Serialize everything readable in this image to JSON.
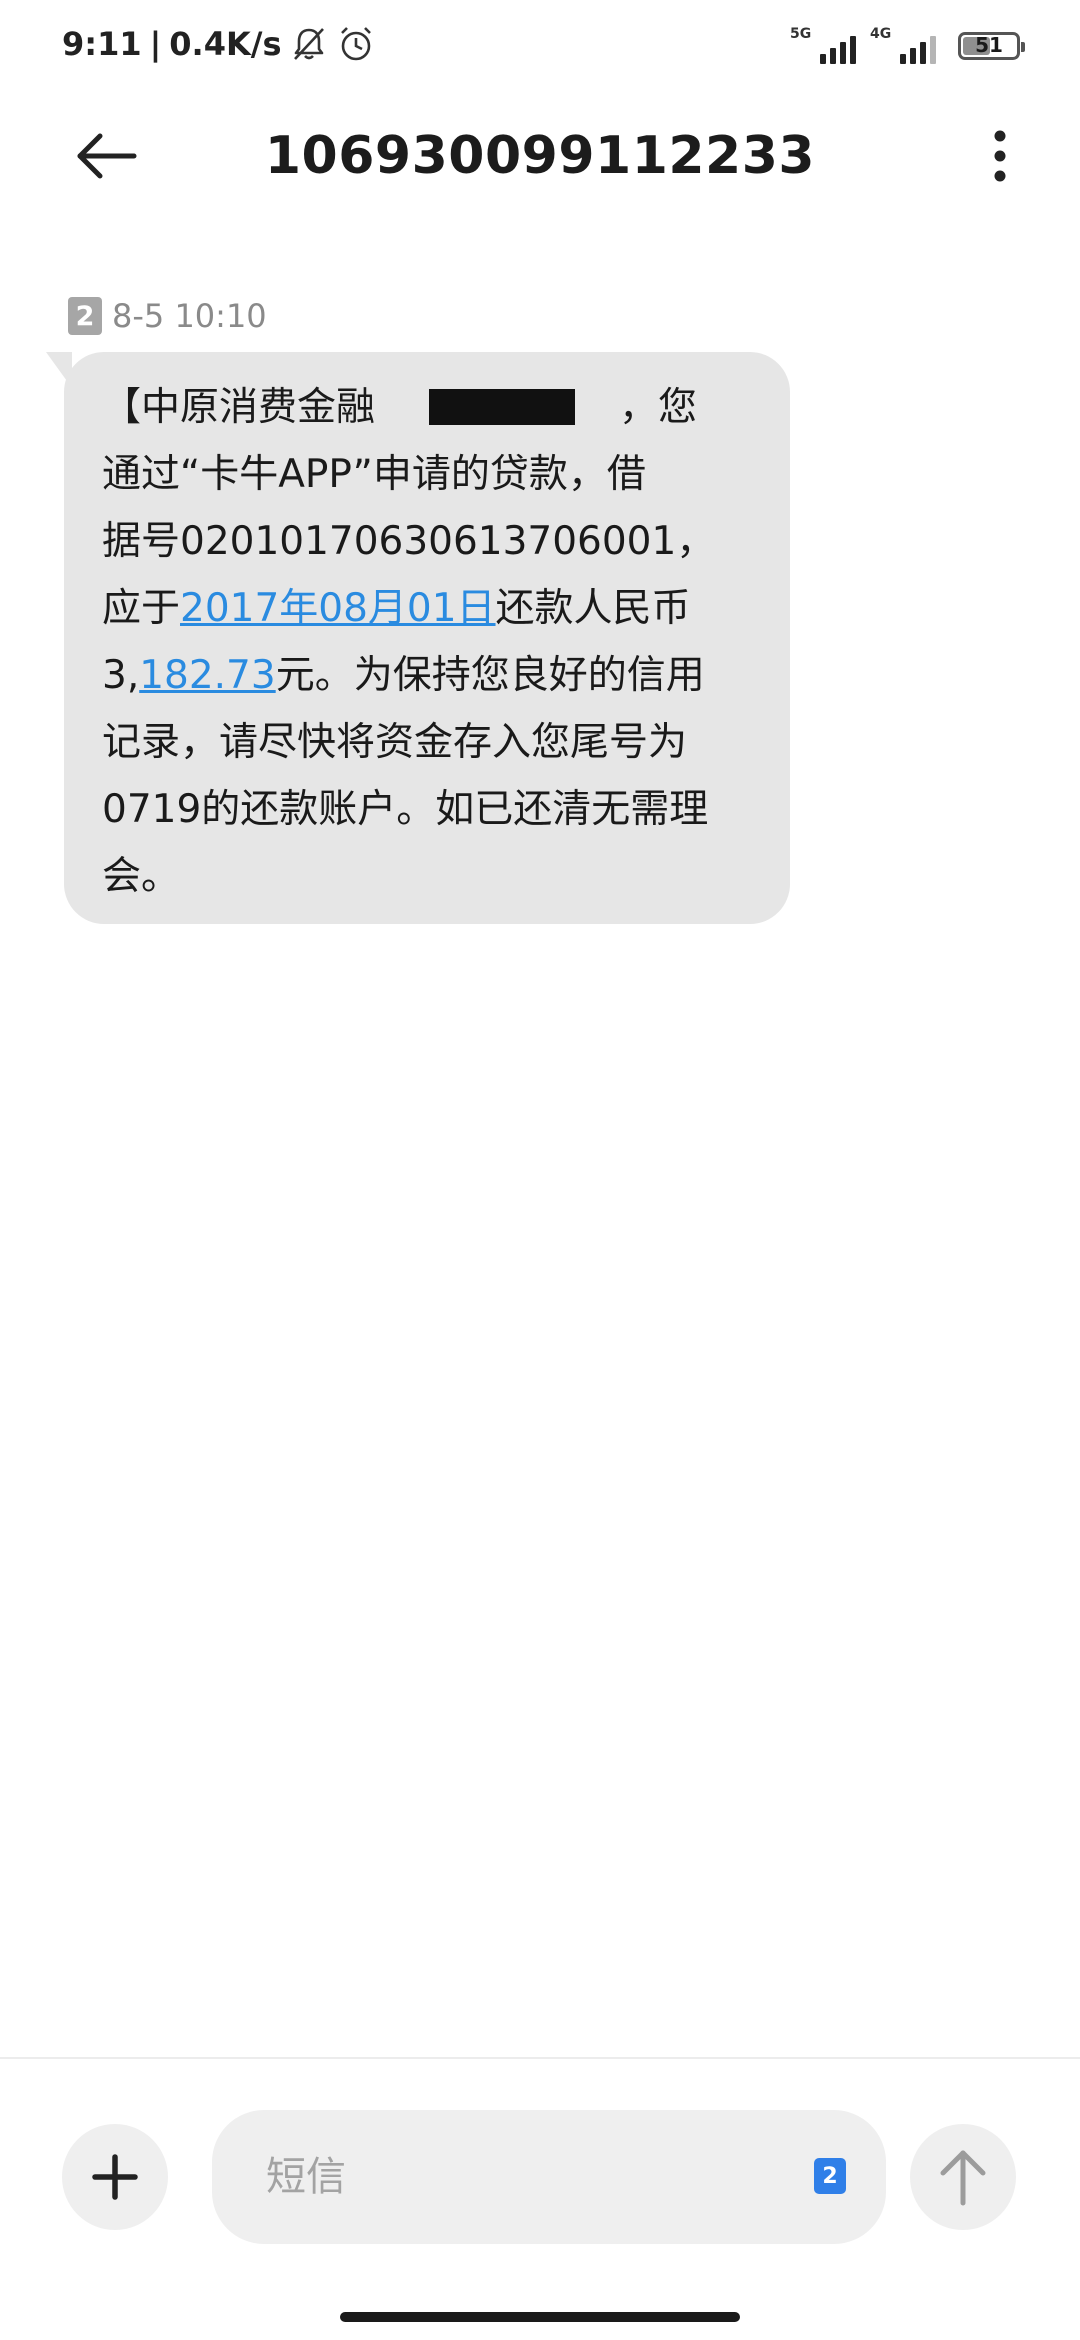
{
  "status_bar": {
    "time": "9:11",
    "separator": "|",
    "network_speed": "0.4K/s",
    "icons": [
      "mute-icon",
      "alarm-icon"
    ],
    "sim1_network": "5G",
    "sim2_network": "4G",
    "battery_level": "51"
  },
  "header": {
    "title": "106930099112233",
    "back_icon": "arrow-left-icon",
    "more_icon": "more-vertical-icon"
  },
  "message": {
    "sim_slot": "2",
    "timestamp": "8-5 10:10",
    "lines": {
      "l1_prefix": "【中原消费金融",
      "l1_suffix": "，您",
      "l2": "通过“卡牛APP”申请的贷款，借",
      "l3": "据号02010170630613706001，",
      "l4_prefix": "应于",
      "l4_link": "2017年08月01日",
      "l4_suffix": "还款人民币",
      "l5_prefix": "3,",
      "l5_link": "182.73",
      "l5_suffix": "元。为保持您良好的信用",
      "l6": "记录，请尽快将资金存入您尾号为",
      "l7": "0719的还款账户。如已还清无需理",
      "l8": "会。"
    }
  },
  "composer": {
    "placeholder": "短信",
    "sim_slot": "2",
    "add_icon": "plus-icon",
    "send_icon": "arrow-up-icon"
  },
  "colors": {
    "link": "#2a8be0",
    "bubble": "#e6e6e6",
    "sim_badge_active": "#2f7fe8"
  }
}
